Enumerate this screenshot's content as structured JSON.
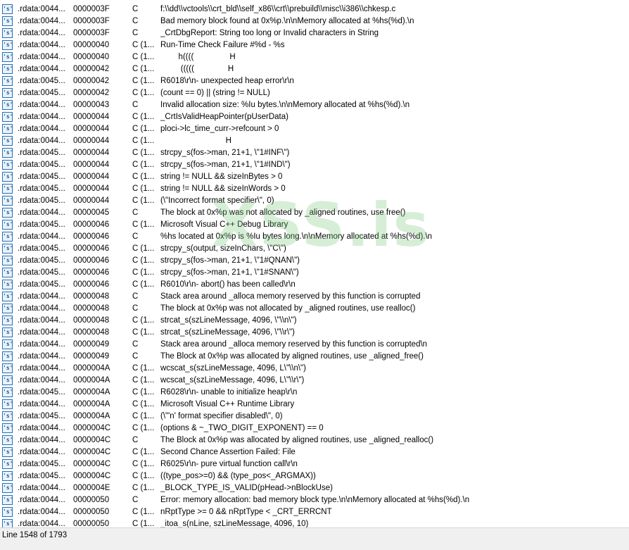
{
  "watermark": "XSS.is",
  "status": {
    "line_text": "Line 1548 of 1793"
  },
  "rows": [
    {
      "addr": ".rdata:0044...",
      "len": "0000003F",
      "type": "C",
      "str": "f:\\\\dd\\\\vctools\\\\crt_bld\\\\self_x86\\\\crt\\\\prebuild\\\\misc\\\\i386\\\\chkesp.c"
    },
    {
      "addr": ".rdata:0044...",
      "len": "0000003F",
      "type": "C",
      "str": "Bad memory block found at 0x%p.\\n\\nMemory allocated at %hs(%d).\\n"
    },
    {
      "addr": ".rdata:0044...",
      "len": "0000003F",
      "type": "C",
      "str": "_CrtDbgReport: String too long or Invalid characters in String"
    },
    {
      "addr": ".rdata:0044...",
      "len": "00000040",
      "type": "C (1...",
      "str": "Run-Time Check Failure #%d - %s"
    },
    {
      "addr": ".rdata:0044...",
      "len": "00000040",
      "type": "C (1...",
      "str": "        h((((                H"
    },
    {
      "addr": ".rdata:0044...",
      "len": "00000042",
      "type": "C (1...",
      "str": "         (((((               H"
    },
    {
      "addr": ".rdata:0045...",
      "len": "00000042",
      "type": "C (1...",
      "str": "R6018\\r\\n- unexpected heap error\\r\\n"
    },
    {
      "addr": ".rdata:0045...",
      "len": "00000042",
      "type": "C (1...",
      "str": "(count == 0) || (string != NULL)"
    },
    {
      "addr": ".rdata:0044...",
      "len": "00000043",
      "type": "C",
      "str": "Invalid allocation size: %Iu bytes.\\n\\nMemory allocated at %hs(%d).\\n"
    },
    {
      "addr": ".rdata:0044...",
      "len": "00000044",
      "type": "C (1...",
      "str": "_CrtIsValidHeapPointer(pUserData)"
    },
    {
      "addr": ".rdata:0044...",
      "len": "00000044",
      "type": "C (1...",
      "str": "ploci->lc_time_curr->refcount > 0"
    },
    {
      "addr": ".rdata:0044...",
      "len": "00000044",
      "type": "C (1...",
      "str": "                             H"
    },
    {
      "addr": ".rdata:0045...",
      "len": "00000044",
      "type": "C (1...",
      "str": "strcpy_s(fos->man, 21+1, \\\"1#INF\\\")"
    },
    {
      "addr": ".rdata:0045...",
      "len": "00000044",
      "type": "C (1...",
      "str": "strcpy_s(fos->man, 21+1, \\\"1#IND\\\")"
    },
    {
      "addr": ".rdata:0045...",
      "len": "00000044",
      "type": "C (1...",
      "str": "string != NULL && sizeInBytes > 0"
    },
    {
      "addr": ".rdata:0045...",
      "len": "00000044",
      "type": "C (1...",
      "str": "string != NULL && sizeInWords > 0"
    },
    {
      "addr": ".rdata:0045...",
      "len": "00000044",
      "type": "C (1...",
      "str": "(\\\"Incorrect format specifier\\\", 0)"
    },
    {
      "addr": ".rdata:0044...",
      "len": "00000045",
      "type": "C",
      "str": "The block at 0x%p was not allocated by _aligned routines, use free()"
    },
    {
      "addr": ".rdata:0045...",
      "len": "00000046",
      "type": "C (1...",
      "str": "Microsoft Visual C++ Debug Library"
    },
    {
      "addr": ".rdata:0044...",
      "len": "00000046",
      "type": "C",
      "str": "%hs located at 0x%p is %Iu bytes long.\\n\\nMemory allocated at %hs(%d).\\n"
    },
    {
      "addr": ".rdata:0045...",
      "len": "00000046",
      "type": "C (1...",
      "str": "strcpy_s(output, sizeInChars, \\\"C\\\")"
    },
    {
      "addr": ".rdata:0045...",
      "len": "00000046",
      "type": "C (1...",
      "str": "strcpy_s(fos->man, 21+1, \\\"1#QNAN\\\")"
    },
    {
      "addr": ".rdata:0045...",
      "len": "00000046",
      "type": "C (1...",
      "str": "strcpy_s(fos->man, 21+1, \\\"1#SNAN\\\")"
    },
    {
      "addr": ".rdata:0045...",
      "len": "00000046",
      "type": "C (1...",
      "str": "R6010\\r\\n- abort() has been called\\r\\n"
    },
    {
      "addr": ".rdata:0044...",
      "len": "00000048",
      "type": "C",
      "str": "Stack area around _alloca memory reserved by this function is corrupted"
    },
    {
      "addr": ".rdata:0044...",
      "len": "00000048",
      "type": "C",
      "str": "The block at 0x%p was not allocated by _aligned routines, use realloc()"
    },
    {
      "addr": ".rdata:0044...",
      "len": "00000048",
      "type": "C (1...",
      "str": "strcat_s(szLineMessage, 4096, \\\"\\\\n\\\")"
    },
    {
      "addr": ".rdata:0044...",
      "len": "00000048",
      "type": "C (1...",
      "str": "strcat_s(szLineMessage, 4096, \\\"\\\\r\\\")"
    },
    {
      "addr": ".rdata:0044...",
      "len": "00000049",
      "type": "C",
      "str": "Stack area around _alloca memory reserved by this function is corrupted\\n"
    },
    {
      "addr": ".rdata:0044...",
      "len": "00000049",
      "type": "C",
      "str": "The Block at 0x%p was allocated by aligned routines, use _aligned_free()"
    },
    {
      "addr": ".rdata:0044...",
      "len": "0000004A",
      "type": "C (1...",
      "str": "wcscat_s(szLineMessage, 4096, L\\\"\\\\n\\\")"
    },
    {
      "addr": ".rdata:0044...",
      "len": "0000004A",
      "type": "C (1...",
      "str": "wcscat_s(szLineMessage, 4096, L\\\"\\\\r\\\")"
    },
    {
      "addr": ".rdata:0045...",
      "len": "0000004A",
      "type": "C (1...",
      "str": "R6028\\r\\n- unable to initialize heap\\r\\n"
    },
    {
      "addr": ".rdata:0044...",
      "len": "0000004A",
      "type": "C (1...",
      "str": "Microsoft Visual C++ Runtime Library"
    },
    {
      "addr": ".rdata:0045...",
      "len": "0000004A",
      "type": "C (1...",
      "str": "(\\\"'n' format specifier disabled\\\", 0)"
    },
    {
      "addr": ".rdata:0044...",
      "len": "0000004C",
      "type": "C (1...",
      "str": "(options & ~_TWO_DIGIT_EXPONENT) == 0"
    },
    {
      "addr": ".rdata:0044...",
      "len": "0000004C",
      "type": "C",
      "str": "The Block at 0x%p was allocated by aligned routines, use _aligned_realloc()"
    },
    {
      "addr": ".rdata:0044...",
      "len": "0000004C",
      "type": "C (1...",
      "str": "Second Chance Assertion Failed: File"
    },
    {
      "addr": ".rdata:0045...",
      "len": "0000004C",
      "type": "C (1...",
      "str": "R6025\\r\\n- pure virtual function call\\r\\n"
    },
    {
      "addr": ".rdata:0045...",
      "len": "0000004C",
      "type": "C (1...",
      "str": "((type_pos>=0) && (type_pos<_ARGMAX))"
    },
    {
      "addr": ".rdata:0044...",
      "len": "0000004E",
      "type": "C (1...",
      "str": "_BLOCK_TYPE_IS_VALID(pHead->nBlockUse)"
    },
    {
      "addr": ".rdata:0044...",
      "len": "00000050",
      "type": "C",
      "str": "Error: memory allocation: bad memory block type.\\n\\nMemory allocated at %hs(%d).\\n"
    },
    {
      "addr": ".rdata:0044...",
      "len": "00000050",
      "type": "C (1...",
      "str": "nRptType >= 0 && nRptType < _CRT_ERRCNT"
    },
    {
      "addr": ".rdata:0044...",
      "len": "00000050",
      "type": "C (1...",
      "str": "_itoa_s(nLine, szLineMessage, 4096, 10)"
    }
  ]
}
